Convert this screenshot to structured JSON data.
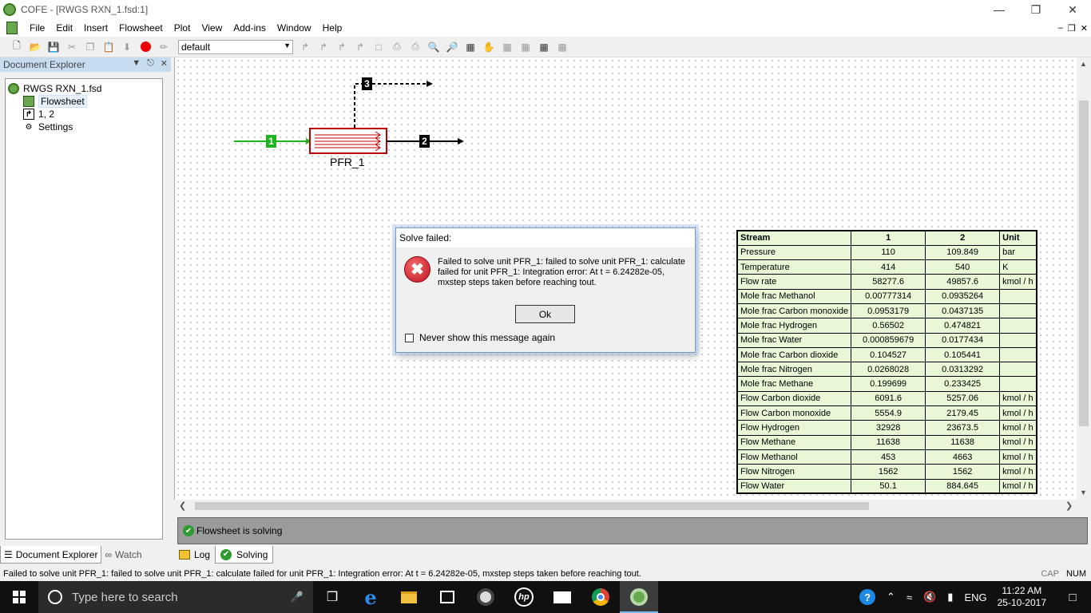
{
  "window": {
    "title": "COFE - [RWGS RXN_1.fsd:1]"
  },
  "menu": [
    "File",
    "Edit",
    "Insert",
    "Flowsheet",
    "Plot",
    "View",
    "Add-ins",
    "Window",
    "Help"
  ],
  "toolbar": {
    "config_select": "default"
  },
  "doc_explorer": {
    "title": "Document Explorer",
    "tree": {
      "root": "RWGS RXN_1.fsd",
      "flowsheet": "Flowsheet",
      "streams": "1, 2",
      "settings": "Settings"
    },
    "tabs": {
      "explorer": "Document Explorer",
      "watch": "Watch"
    }
  },
  "flowsheet": {
    "unit_name": "PFR_1",
    "streams": {
      "s1": "1",
      "s2": "2",
      "s3": "3"
    },
    "colors": {
      "inlet_stream": "#1eb41e",
      "unit_border": "#c00000"
    }
  },
  "stream_table": {
    "headers": [
      "Stream",
      "1",
      "2",
      "Unit"
    ],
    "rows": [
      [
        "Pressure",
        "110",
        "109.849",
        "bar"
      ],
      [
        "Temperature",
        "414",
        "540",
        "K"
      ],
      [
        "Flow rate",
        "58277.6",
        "49857.6",
        "kmol / h"
      ],
      [
        "Mole frac Methanol",
        "0.00777314",
        "0.0935264",
        ""
      ],
      [
        "Mole frac Carbon monoxide",
        "0.0953179",
        "0.0437135",
        ""
      ],
      [
        "Mole frac Hydrogen",
        "0.56502",
        "0.474821",
        ""
      ],
      [
        "Mole frac Water",
        "0.000859679",
        "0.0177434",
        ""
      ],
      [
        "Mole frac Carbon dioxide",
        "0.104527",
        "0.105441",
        ""
      ],
      [
        "Mole frac Nitrogen",
        "0.0268028",
        "0.0313292",
        ""
      ],
      [
        "Mole frac Methane",
        "0.199699",
        "0.233425",
        ""
      ],
      [
        "Flow Carbon dioxide",
        "6091.6",
        "5257.06",
        "kmol / h"
      ],
      [
        "Flow Carbon monoxide",
        "5554.9",
        "2179.45",
        "kmol / h"
      ],
      [
        "Flow Hydrogen",
        "32928",
        "23673.5",
        "kmol / h"
      ],
      [
        "Flow Methane",
        "11638",
        "11638",
        "kmol / h"
      ],
      [
        "Flow Methanol",
        "453",
        "4663",
        "kmol / h"
      ],
      [
        "Flow Nitrogen",
        "1562",
        "1562",
        "kmol / h"
      ],
      [
        "Flow Water",
        "50.1",
        "884.645",
        "kmol / h"
      ]
    ]
  },
  "dialog": {
    "title": "Solve failed:",
    "message": "Failed to solve unit PFR_1: failed to solve unit PFR_1: calculate failed for unit PFR_1: Integration error: At t = 6.24282e-05, mxstep steps taken before reaching tout.",
    "ok": "Ok",
    "checkbox": "Never show this message again"
  },
  "bottom_panel": {
    "status": "Flowsheet is solving",
    "tabs": {
      "log": "Log",
      "solving": "Solving"
    }
  },
  "statusline": {
    "message": "Failed to solve unit PFR_1: failed to solve unit PFR_1: calculate failed for unit PFR_1: Integration error: At t = 6.24282e-05, mxstep steps taken before reaching tout.",
    "cap": "CAP",
    "num": "NUM"
  },
  "taskbar": {
    "search_placeholder": "Type here to search",
    "lang": "ENG",
    "time": "11:22 AM",
    "date": "25-10-2017"
  }
}
